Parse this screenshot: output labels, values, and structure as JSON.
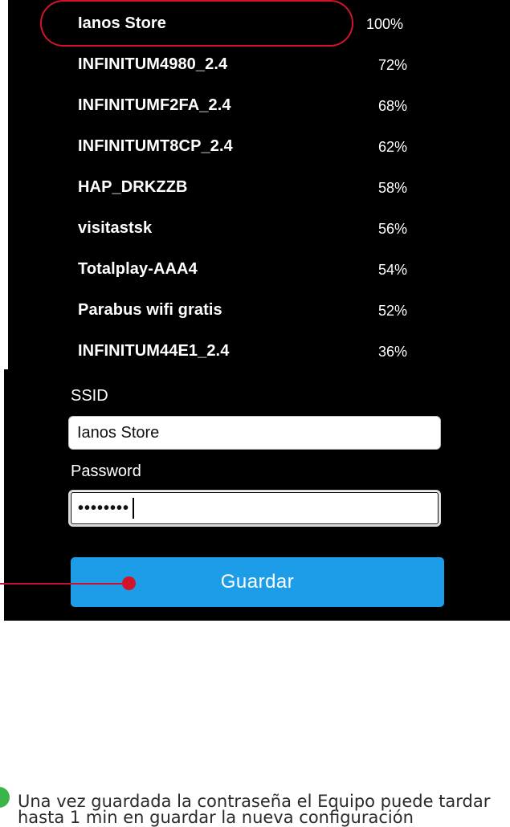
{
  "networks": [
    {
      "name": "Ianos Store",
      "signal": "100%"
    },
    {
      "name": "INFINITUM4980_2.4",
      "signal": "72%"
    },
    {
      "name": "INFINITUMF2FA_2.4",
      "signal": "68%"
    },
    {
      "name": "INFINITUMT8CP_2.4",
      "signal": "62%"
    },
    {
      "name": "HAP_DRKZZB",
      "signal": "58%"
    },
    {
      "name": "visitastsk",
      "signal": "56%"
    },
    {
      "name": "Totalplay-AAA4",
      "signal": "54%"
    },
    {
      "name": "Parabus wifi gratis",
      "signal": "52%"
    },
    {
      "name": "INFINITUM44E1_2.4",
      "signal": "36%"
    }
  ],
  "form": {
    "ssid_label": "SSID",
    "ssid_value": "Ianos Store",
    "password_label": "Password",
    "password_value": "••••••••",
    "save_label": "Guardar"
  },
  "annotation": {
    "highlight_color": "#d3132a",
    "note_color": "#3bb44a",
    "note": "Una vez guardada la contraseña el Equipo puede tardar hasta 1 min en guardar la nueva  configuración"
  }
}
